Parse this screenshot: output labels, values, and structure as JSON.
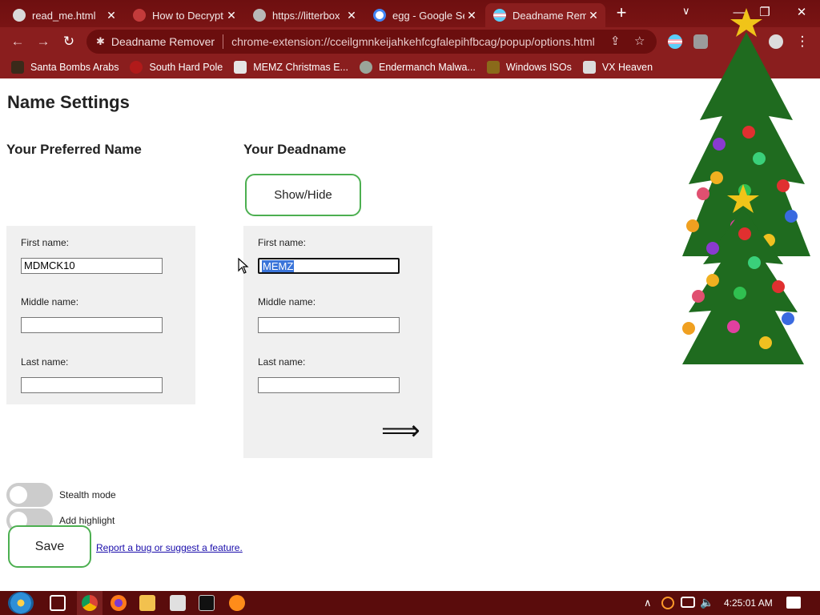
{
  "browser": {
    "tabs": [
      {
        "title": "read_me.html",
        "favicon_color": "#d9d9d9"
      },
      {
        "title": "How to Decrypt",
        "favicon_color": "#c43b3b"
      },
      {
        "title": "https://litterbox",
        "favicon_color": "#b8b8b8"
      },
      {
        "title": "egg - Google Search",
        "favicon_color": "#4285f4"
      },
      {
        "title": "Deadname Remover",
        "favicon_color": "#f4a6b8",
        "active": true
      }
    ],
    "new_tab": "+",
    "tab_search": "∨",
    "window_buttons": {
      "minimize": "—",
      "restore": "❐",
      "close": "✕"
    },
    "nav": {
      "back": "←",
      "forward": "→",
      "reload": "↻"
    },
    "omnibox": {
      "extension_name": "Deadname Remover",
      "url": "chrome-extension://cceilgmnkeijahkehfcgfalepihfbcag/popup/options.html"
    },
    "bookmarks": [
      {
        "label": "Santa Bombs Arabs",
        "icon_color": "#3a2a1a"
      },
      {
        "label": "South Hard Pole",
        "icon_color": "#b11a1a"
      },
      {
        "label": "MEMZ Christmas E...",
        "icon_color": "#e5e5e5"
      },
      {
        "label": "Endermanch Malwa...",
        "icon_color": "#9aa59a"
      },
      {
        "label": "Windows ISOs",
        "icon_color": "#8a6a1a"
      },
      {
        "label": "VX Heaven",
        "icon_color": "#dcdcdc"
      }
    ]
  },
  "page": {
    "title": "Name Settings",
    "preferred": {
      "heading": "Your Preferred Name",
      "first_label": "First name:",
      "first_value": "MDMCK10",
      "middle_label": "Middle name:",
      "middle_value": "",
      "last_label": "Last name:",
      "last_value": ""
    },
    "deadname": {
      "heading": "Your Deadname",
      "show_hide": "Show/Hide",
      "first_label": "First name:",
      "first_value": "MEMZ",
      "middle_label": "Middle name:",
      "middle_value": "",
      "last_label": "Last name:",
      "last_value": ""
    },
    "add_arrow": "⟹",
    "toggles": {
      "stealth": "Stealth mode",
      "highlight": "Add highlight"
    },
    "save": "Save",
    "report_link": "Report a bug or suggest a feature."
  },
  "taskbar": {
    "clock": "4:25:01 AM",
    "tray_up": "∧"
  },
  "colors": {
    "accent_green": "#4caf50",
    "chrome_red": "#8a1e1e",
    "selection_blue": "#3a74d9"
  }
}
